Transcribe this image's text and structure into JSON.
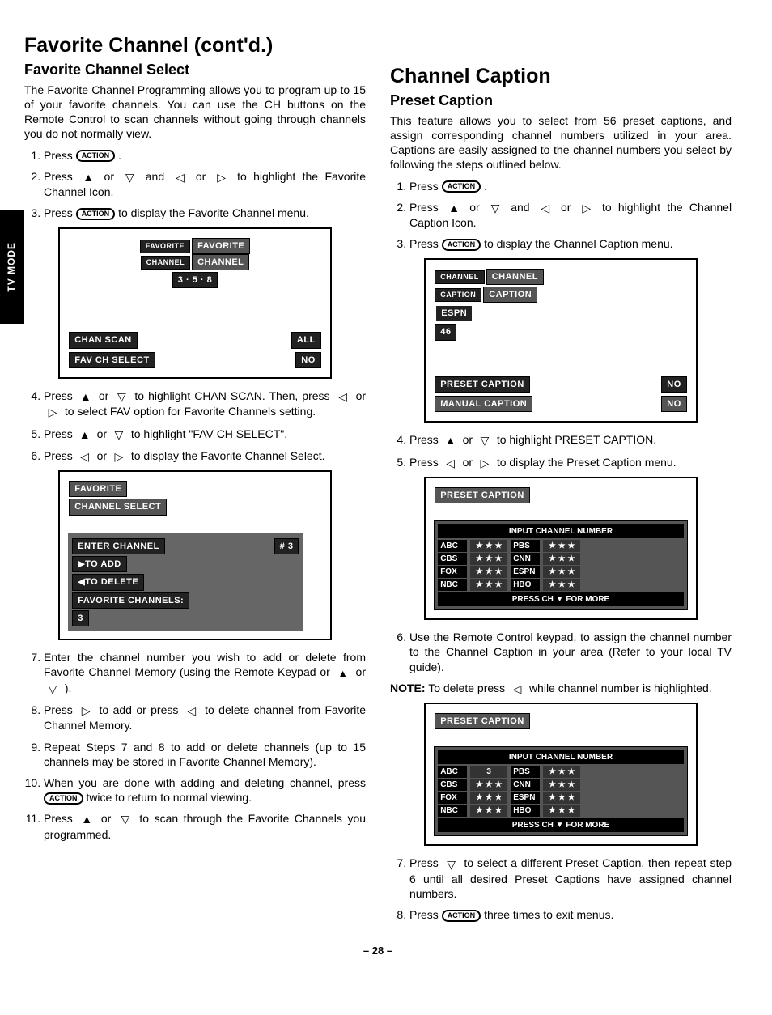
{
  "sideTab": "TV MODE",
  "pageNumber": "– 28 –",
  "icons": {
    "action": "ACTION",
    "up": "▲",
    "down": "▽",
    "left": "◁",
    "right": "▷",
    "ch": "CH"
  },
  "left": {
    "h1": "Favorite Channel (cont'd.)",
    "h2": "Favorite Channel Select",
    "intro": "The Favorite Channel Programming allows you to program up to 15 of your favorite channels. You can use the CH buttons on the Remote Control to scan channels without going through channels you do not normally view.",
    "steps": {
      "s1a": "Press",
      "s1b": ".",
      "s2a": "Press",
      "s2b": "or",
      "s2c": "and",
      "s2d": "or",
      "s2e": "to highlight the Favorite Channel Icon.",
      "s3a": "Press",
      "s3b": "to display the Favorite Channel menu.",
      "s4a": "Press",
      "s4b": "or",
      "s4c": "to highlight CHAN SCAN. Then, press",
      "s4d": "or",
      "s4e": "to select FAV option for Favorite Channels setting.",
      "s5a": "Press",
      "s5b": "or",
      "s5c": "to highlight \"FAV CH SELECT\".",
      "s6a": "Press",
      "s6b": "or",
      "s6c": "to display the Favorite Channel Select.",
      "s7a": "Enter the channel number you wish to add or delete from Favorite Channel Memory (using the Remote Keypad or",
      "s7b": "or",
      "s7c": ").",
      "s8a": "Press",
      "s8b": "to add or press",
      "s8c": "to delete channel from Favorite Channel Memory.",
      "s9": "Repeat Steps 7 and 8 to add or delete channels (up to 15 channels may be stored in Favorite Channel Memory).",
      "s10a": "When you are done with adding and deleting channel, press",
      "s10b": "twice to return to normal viewing.",
      "s11a": "Press",
      "s11b": "or",
      "s11c": "to scan through the Favorite Channels you programmed."
    },
    "screen1": {
      "l1a": "FAVORITE",
      "l1b": "FAVORITE",
      "l2a": "CHANNEL",
      "l2b": "CHANNEL",
      "nums": "3 · 5 · 8",
      "row1a": "CHAN SCAN",
      "row1b": "ALL",
      "row2a": "FAV CH SELECT",
      "row2b": "NO"
    },
    "screen2": {
      "t1": "FAVORITE",
      "t2": "CHANNEL SELECT",
      "r1a": "ENTER CHANNEL",
      "r1b": "# 3",
      "r2": "▶TO ADD",
      "r3": "◀TO DELETE",
      "r4": "FAVORITE CHANNELS:",
      "r5": "3"
    }
  },
  "right": {
    "h1": "Channel Caption",
    "h2": "Preset Caption",
    "intro": "This feature allows you to select from 56 preset captions, and assign corresponding channel numbers utilized in your area. Captions are easily assigned to the channel numbers you select by following the steps outlined below.",
    "steps": {
      "s1a": "Press",
      "s1b": ".",
      "s2a": "Press",
      "s2b": "or",
      "s2c": "and",
      "s2d": "or",
      "s2e": "to highlight the Channel Caption Icon.",
      "s3a": "Press",
      "s3b": "to display the Channel Caption menu.",
      "s4a": "Press",
      "s4b": "or",
      "s4c": "to highlight PRESET CAPTION.",
      "s5a": "Press",
      "s5b": "or",
      "s5c": "to display the Preset Caption menu.",
      "s6": "Use the Remote Control keypad, to assign the channel number to the Channel Caption in your area (Refer to your local TV guide).",
      "noteLabel": "NOTE:",
      "noteText1": "To delete press",
      "noteText2": "while channel number is highlighted.",
      "s7a": "Press",
      "s7b": "to select a different Preset Caption, then repeat step 6 until all desired Preset Captions have assigned channel numbers.",
      "s8a": "Press",
      "s8b": "three times to exit menus."
    },
    "screen1": {
      "l1a": "CHANNEL",
      "l1b": "CHANNEL",
      "l2a": "CAPTION",
      "l2b": "CAPTION",
      "box1": "ESPN",
      "box2": "46",
      "row1a": "PRESET CAPTION",
      "row1b": "NO",
      "row2a": "MANUAL CAPTION",
      "row2b": "NO"
    },
    "presetTable": {
      "title": "PRESET CAPTION",
      "header": "INPUT CHANNEL NUMBER",
      "footer": "PRESS CH ▼ FOR MORE",
      "stars": "★ ★ ★",
      "rows": [
        {
          "n1": "ABC",
          "v1": "★ ★ ★",
          "n2": "PBS",
          "v2": "★ ★ ★"
        },
        {
          "n1": "CBS",
          "v1": "★ ★ ★",
          "n2": "CNN",
          "v2": "★ ★ ★"
        },
        {
          "n1": "FOX",
          "v1": "★ ★ ★",
          "n2": "ESPN",
          "v2": "★ ★ ★"
        },
        {
          "n1": "NBC",
          "v1": "★ ★ ★",
          "n2": "HBO",
          "v2": "★ ★ ★"
        }
      ],
      "rows2": [
        {
          "n1": "ABC",
          "v1": "3",
          "n2": "PBS",
          "v2": "★ ★ ★"
        },
        {
          "n1": "CBS",
          "v1": "★ ★ ★",
          "n2": "CNN",
          "v2": "★ ★ ★"
        },
        {
          "n1": "FOX",
          "v1": "★ ★ ★",
          "n2": "ESPN",
          "v2": "★ ★ ★"
        },
        {
          "n1": "NBC",
          "v1": "★ ★ ★",
          "n2": "HBO",
          "v2": "★ ★ ★"
        }
      ]
    }
  }
}
